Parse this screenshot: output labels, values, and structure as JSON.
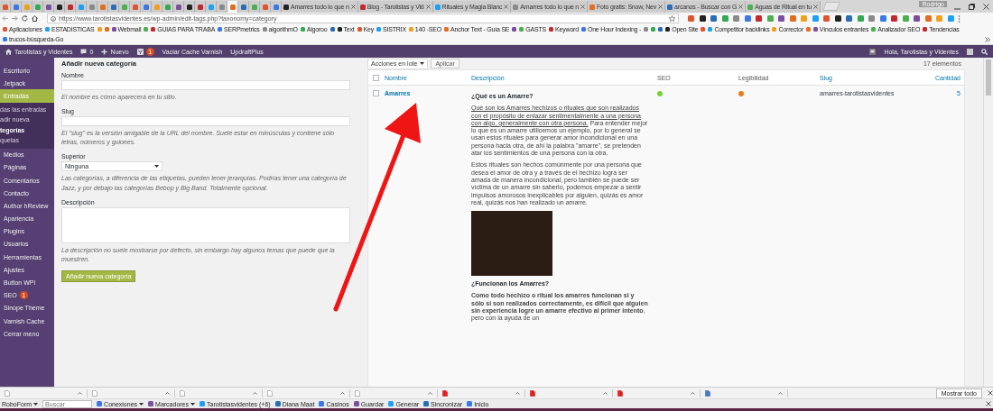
{
  "browser": {
    "tabs": [
      {
        "selected": false
      },
      {
        "selected": false
      },
      {
        "selected": false
      },
      {
        "selected": false
      },
      {
        "selected": false
      },
      {
        "selected": false
      },
      {
        "selected": false
      },
      {
        "selected": false
      },
      {
        "selected": false
      },
      {
        "selected": false
      },
      {
        "selected": false
      },
      {
        "selected": false
      },
      {
        "selected": false
      },
      {
        "selected": false
      },
      {
        "selected": false
      },
      {
        "selected": false
      },
      {
        "selected": false
      },
      {
        "selected": false
      },
      {
        "selected": false
      },
      {
        "selected": false
      },
      {
        "selected": false
      },
      {
        "selected": true
      },
      {
        "selected": false
      },
      {
        "selected": false
      },
      {
        "selected": false
      },
      {
        "selected": false
      },
      {
        "title": "Amarres todo lo que n",
        "selected": false
      },
      {
        "title": "Blog - Tarotistas y Vid",
        "selected": false
      },
      {
        "title": "Rituales y Magia Blanc",
        "selected": false
      },
      {
        "title": "Amarres todo lo que n",
        "selected": false
      },
      {
        "title": "Foto gratis: Snow, Nev",
        "selected": false
      },
      {
        "title": "arcanos - Buscar con G",
        "selected": false
      },
      {
        "title": "Aguas de Ritual en tu",
        "selected": false
      }
    ],
    "profile_name": "Rodrigo",
    "url": "https://www.tarotistasvidentes.es/wp-admin/edit-tags.php?taxonomy=category",
    "bookmarks": [
      {
        "kind": "link",
        "label": "Aplicaciones"
      },
      {
        "kind": "link",
        "label": "ESTADISTICAS"
      },
      {
        "kind": "icon"
      },
      {
        "kind": "icon"
      },
      {
        "kind": "link",
        "label": "Webmail"
      },
      {
        "kind": "icon"
      },
      {
        "kind": "link",
        "label": "GUIAS PARA TRABA"
      },
      {
        "kind": "link",
        "label": "SERPmetrics"
      },
      {
        "kind": "link",
        "label": "algorithmO"
      },
      {
        "kind": "link",
        "label": "Algoroo"
      },
      {
        "kind": "icon"
      },
      {
        "kind": "link",
        "label": "Text"
      },
      {
        "kind": "link",
        "label": "Key"
      },
      {
        "kind": "link",
        "label": "SISTRIX"
      },
      {
        "kind": "link",
        "label": "140 -SEO"
      },
      {
        "kind": "link",
        "label": "Anchor Text - Guía SE"
      },
      {
        "kind": "icon"
      },
      {
        "kind": "link",
        "label": "GASTS"
      },
      {
        "kind": "link",
        "label": "Keyword"
      },
      {
        "kind": "link",
        "label": "One Hour Indexing -"
      },
      {
        "kind": "icon"
      },
      {
        "kind": "icon"
      },
      {
        "kind": "icon"
      },
      {
        "kind": "link",
        "label": "Open Site"
      },
      {
        "kind": "icon"
      },
      {
        "kind": "link",
        "label": "Competitor backlinks"
      },
      {
        "kind": "link",
        "label": "Corrector"
      },
      {
        "kind": "icon"
      },
      {
        "kind": "link",
        "label": "Vínculos entrantes"
      },
      {
        "kind": "link",
        "label": "Analizador SEO"
      },
      {
        "kind": "link",
        "label": "Tendencias"
      },
      {
        "kind": "link",
        "label": "trucos-búsqueda-Go"
      }
    ]
  },
  "admin_bar": {
    "site": "Tarotistas y Videntes",
    "comments": "0",
    "new": "Nuevo",
    "seo_badge": "1",
    "items": [
      "Vaciar Cache Varnish",
      "UpdraftPlus"
    ],
    "greeting": "Hola, Tarotistas y Videntes"
  },
  "sidebar": {
    "items": [
      {
        "label": "Escritorio",
        "selected": false
      },
      {
        "label": "Jetpack",
        "selected": false
      },
      {
        "label": "Entradas",
        "selected": true,
        "children": [
          {
            "label": "das las entradas",
            "selected": false
          },
          {
            "label": "adir nueva",
            "selected": false
          },
          {
            "label": "tegorías",
            "selected": true
          },
          {
            "label": "quetas",
            "selected": false
          }
        ]
      },
      {
        "label": "Medios",
        "selected": false
      },
      {
        "label": "Páginas",
        "selected": false
      },
      {
        "label": "Comentarios",
        "selected": false
      },
      {
        "label": "Contacto",
        "selected": false
      },
      {
        "label": "Author hReview",
        "selected": false
      },
      {
        "label": "Apariencia",
        "selected": false
      },
      {
        "label": "Plugins",
        "selected": false
      },
      {
        "label": "Usuarios",
        "selected": false
      },
      {
        "label": "Herramientas",
        "selected": false
      },
      {
        "label": "Ajustes",
        "selected": false
      },
      {
        "label": "Button WPi",
        "selected": false
      },
      {
        "label": "SEO",
        "badge": "1",
        "selected": false
      },
      {
        "label": "Sinope Theme",
        "selected": false
      },
      {
        "label": "Varnish Cache",
        "selected": false
      },
      {
        "label": "Cerrar menú",
        "selected": false
      }
    ]
  },
  "form": {
    "heading": "Añadir nueva categoría",
    "fields": [
      {
        "kind": "text",
        "label": "Nombre",
        "help": "El nombre es cómo aparecerá en tu sitio."
      },
      {
        "kind": "text",
        "label": "Slug",
        "help": "El \"slug\" es la versión amigable de la URL del nombre. Suele estar en minúsculas y contiene sólo letras, números y guiones."
      },
      {
        "kind": "select",
        "label": "Superior",
        "value": "Ninguna",
        "help": "Las categorías, a diferencia de las etiquetas, pueden tener jerarquías. Podrías tener una categoría de Jazz, y por debajo las categorías Bebop y Big Band. Totalmente opcional."
      },
      {
        "kind": "textarea",
        "label": "Descripción",
        "help": "La descripción no suele mostrarse por defecto, sin embargo hay algunos temas que puede que la muestren."
      }
    ],
    "submit": "Añadir nueva categoría"
  },
  "table": {
    "bulk_action": "Acciones en lote",
    "apply": "Aplicar",
    "count": "17 elementos",
    "select_all": {
      "checked": false
    },
    "columns": [
      "Nombre",
      "Descripción",
      "SEO",
      "Legibilidad",
      "Slug",
      "Cantidad"
    ],
    "rows": [
      {
        "checked": false,
        "name": "Amarres",
        "description": [
          {
            "kind": "heading",
            "text": "¿Qué es un Amarre?"
          },
          {
            "kind": "paragraph",
            "link": "Qué son los Amarres hechizos o rituales que son realizados con el propósito de enlazar sentimentalmente a una persona con algo, generalmente con otra persona.",
            "text": " Para entender mejor lo que es un amarre utilicemos un ejemplo, por lo general se usan estos rituales para generar amor incondicional en una persona hacia otra, de ahí la palabra \"amarre\", se pretenden atar los sentimientos de una persona con la otra."
          },
          {
            "kind": "paragraph",
            "text": "Estos rituales son hechos comúnmente por una persona que desea el amor de otra y a través de el hechizo logra ser amada de manera incondicional, pero también se puede ser víctima de un amarre sin saberlo, podemos empezar a sentir impulsos amorosos inexplicables por alguien, quizás es amor real, quizás nos han realizado un amarre."
          },
          {
            "kind": "image"
          },
          {
            "kind": "heading",
            "text": "¿Funcionan los Amarres?"
          },
          {
            "kind": "paragraph",
            "text": "**Como todo hechizo o ritual los amarres funcionan si y sólo si son realizados correctamente, es difícil que alguien sin experiencia logre un amarre efectivo al primer intento**, pero con la ayuda de un"
          }
        ],
        "seo": {
          "color": "#7ad03a"
        },
        "readability": {
          "color": "#ee7c1b"
        },
        "slug": "amarres-tarotistasvidentes",
        "count": "5"
      }
    ]
  },
  "downloads": {
    "button": "Mostrar todo"
  },
  "roboform": {
    "name": "RoboForm",
    "search_placeholder": "Buscar",
    "items": [
      {
        "label": "Conexiones",
        "menu": true
      },
      {
        "label": "Marcadores",
        "menu": true
      },
      {
        "label": "Tarotistasvidentes (+6)",
        "menu": false
      },
      {
        "label": "Diana Maat",
        "menu": false
      },
      {
        "label": "Casinos",
        "menu": false
      },
      {
        "label": "Guardar",
        "menu": false
      },
      {
        "label": "Generar",
        "menu": false
      },
      {
        "label": "Sincronizar",
        "menu": false
      },
      {
        "label": "Inicio",
        "menu": false
      }
    ]
  }
}
